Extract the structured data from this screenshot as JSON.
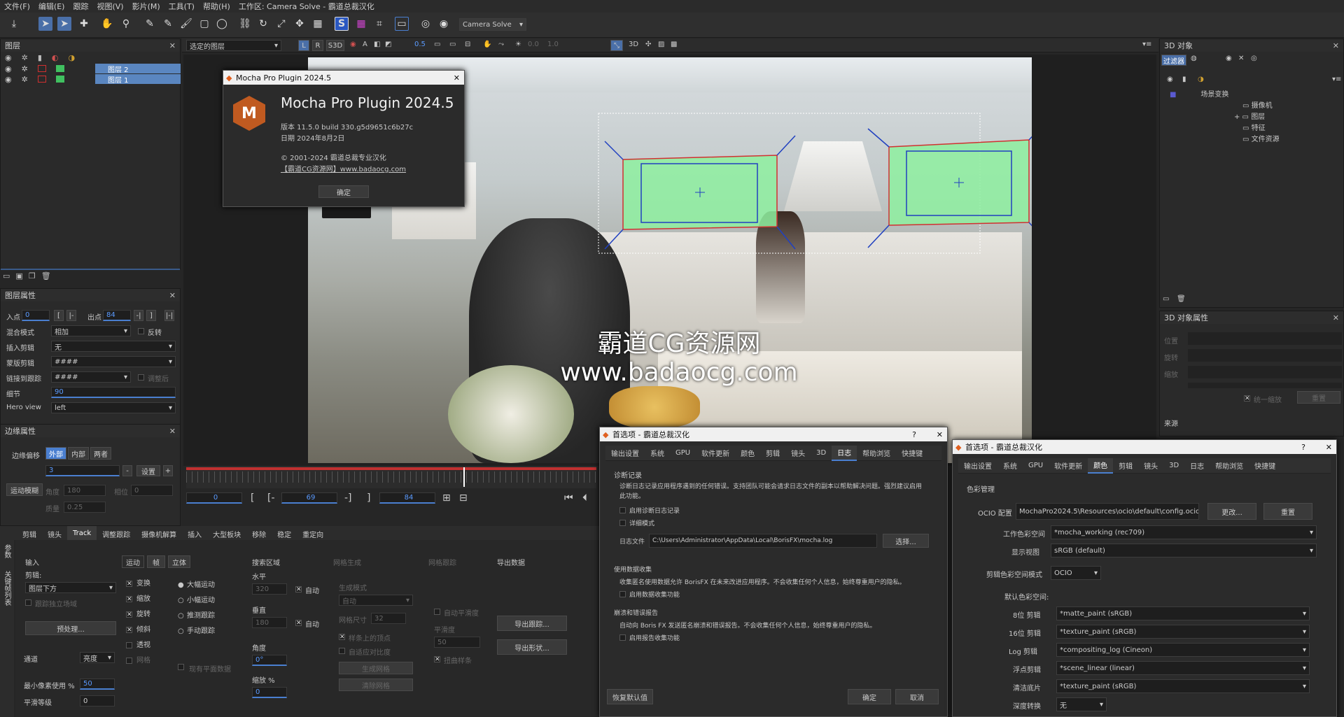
{
  "menu": [
    "文件(F)",
    "编辑(E)",
    "跟踪",
    "视图(V)",
    "影片(M)",
    "工具(T)",
    "帮助(H)",
    "工作区: Camera Solve - 霸道总裁汉化"
  ],
  "toolbar": {
    "workspace_select": "Camera Solve"
  },
  "subbar": {
    "layer_select": "选定的图层",
    "btn_l": "L",
    "btn_r": "R",
    "btn_s3d": "S3D",
    "opacity": "0.5",
    "val1": "0.0",
    "val2": "1.0",
    "btn_3d": "3D"
  },
  "layers_panel": {
    "title": "图层",
    "layers": [
      "图层 2",
      "图层 1"
    ]
  },
  "layer_props": {
    "title": "图层属性",
    "in_label": "入点",
    "in_value": "0",
    "out_label": "出点",
    "out_value": "84",
    "blend_label": "混合模式",
    "blend_value": "相加",
    "invert_label": "反转",
    "insert_label": "插入剪辑",
    "insert_value": "无",
    "matte_label": "蒙版剪辑",
    "matte_value": "####",
    "link_label": "链接到跟踪",
    "link_value": "####",
    "link_after": "调整后",
    "detail_label": "细节",
    "detail_value": "90",
    "hero_label": "Hero view",
    "hero_value": "left"
  },
  "edge_props": {
    "title": "边缘属性",
    "offset_label": "边缘偏移",
    "opt_out": "外部",
    "opt_in": "内部",
    "opt_both": "两者",
    "value": "3",
    "set_label": "设置",
    "motion_blur": "运动模糊",
    "angle_label": "角度",
    "angle_value": "180",
    "phase_label": "相位",
    "phase_value": "0",
    "quality_label": "质量",
    "quality_value": "0.25"
  },
  "bottom_tabs": [
    "剪辑",
    "镜头",
    "Track",
    "调整跟踪",
    "摄像机解算",
    "插入",
    "大型板块",
    "移除",
    "稳定",
    "重定向"
  ],
  "side_tabs": [
    "参数",
    "关键帧列表"
  ],
  "track_params": {
    "input_title": "输入",
    "clip_label": "剪辑:",
    "clip_value": "图层下方",
    "track_separate": "跟踪独立场域",
    "preprocess": "预处理...",
    "channel_label": "通道",
    "channel_value": "亮度",
    "min_pixels_label": "最小像素使用 %",
    "min_pixels_value": "50",
    "smooth_label": "平滑等级",
    "smooth_value": "0",
    "motion_tabs": [
      "运动",
      "帧",
      "立体"
    ],
    "motion_checks": [
      {
        "label": "变换",
        "on": true
      },
      {
        "label": "缩放",
        "on": true
      },
      {
        "label": "旋转",
        "on": true
      },
      {
        "label": "倾斜",
        "on": true
      },
      {
        "label": "透视",
        "on": false
      },
      {
        "label": "网格",
        "on": false
      }
    ],
    "motion_radios": [
      {
        "label": "大幅运动",
        "on": true
      },
      {
        "label": "小幅运动",
        "on": false
      },
      {
        "label": "推测跟踪",
        "on": false
      },
      {
        "label": "手动跟踪",
        "on": false
      }
    ],
    "existing_planar": "现有平面数据",
    "search_title": "搜索区域",
    "horiz_label": "水平",
    "horiz_value": "320",
    "auto1": "自动",
    "vert_label": "垂直",
    "vert_value": "180",
    "auto2": "自动",
    "angle_label": "角度",
    "angle_value": "0°",
    "zoom_label": "缩放 %",
    "zoom_value": "0",
    "mesh_gen_title": "网格生成",
    "gen_mode_label": "生成模式",
    "gen_mode_value": "自动",
    "mesh_size_label": "网格尺寸",
    "mesh_size_value": "32",
    "snap_label": "样条上的顶点",
    "adaptive_label": "自适应对比度",
    "gen_mesh_btn": "生成网格",
    "clear_mesh_btn": "清除网格",
    "mesh_track_title": "网格跟踪",
    "auto_smooth": "自动平滑度",
    "smoothness_label": "平滑度",
    "smoothness_value": "50",
    "warp_label": "扭曲样条",
    "export_title": "导出数据",
    "export_track": "导出跟踪...",
    "export_shape": "导出形状..."
  },
  "timeline": {
    "start": "0",
    "mid": "69",
    "end": "84"
  },
  "objects_panel": {
    "title": "3D 对象",
    "filter": "过滤器",
    "tree": [
      "场景变换",
      "摄像机",
      "图层",
      "特征",
      "文件资源"
    ]
  },
  "objects_props": {
    "title": "3D 对象属性",
    "rows": [
      "位置",
      "旋转",
      "缩放"
    ],
    "uniform_label": "统一缩放",
    "reset_label": "重置",
    "source_label": "来源"
  },
  "about": {
    "title": "Mocha Pro Plugin 2024.5",
    "heading": "Mocha Pro Plugin 2024.5",
    "logo": "M",
    "version": "版本 11.5.0 build 330.g5d9651c6b27c",
    "date": "日期 2024年8月2日",
    "copyright": "© 2001-2024 霸道总裁专业汉化",
    "link": "【霸道CG资源网】www.badaocg.com",
    "ok": "确定"
  },
  "watermark": {
    "line1": "霸道CG资源网",
    "line2": "www.badaocg.com"
  },
  "prefs1": {
    "title": "首选项 - 霸道总裁汉化",
    "help": "?",
    "tabs": [
      "输出设置",
      "系统",
      "GPU",
      "软件更新",
      "颜色",
      "剪辑",
      "镜头",
      "3D",
      "日志",
      "帮助浏览",
      "快捷键"
    ],
    "active": 8,
    "diag_title": "诊断记录",
    "diag_text": "诊断日志记录应用程序遇到的任何错误。支持团队可能会请求日志文件的副本以帮助解决问题。强烈建议启用此功能。",
    "enable_diag": "启用诊断日志记录",
    "verbose": "详细模式",
    "log_file_label": "日志文件",
    "log_file": "C:\\Users\\Administrator\\AppData\\Local\\BorisFX\\mocha.log",
    "choose": "选择...",
    "usage_title": "使用数据收集",
    "usage_text": "收集匿名使用数据允许 BorisFX 在未来改进应用程序。不会收集任何个人信息，始终尊重用户的隐私。",
    "enable_usage": "启用数据收集功能",
    "crash_title": "崩溃和错误报告",
    "crash_text": "自动向 Boris FX 发送匿名崩溃和错误报告。不会收集任何个人信息，始终尊重用户的隐私。",
    "enable_crash": "启用报告收集功能",
    "restore": "恢复默认值",
    "ok": "确定",
    "cancel": "取消"
  },
  "prefs2": {
    "title": "首选项 - 霸道总裁汉化",
    "help": "?",
    "tabs": [
      "输出设置",
      "系统",
      "GPU",
      "软件更新",
      "颜色",
      "剪辑",
      "镜头",
      "3D",
      "日志",
      "帮助浏览",
      "快捷键"
    ],
    "active": 4,
    "section": "色彩管理",
    "ocio_label": "OCIO 配置",
    "ocio_value": "MochaPro2024.5\\Resources\\ocio\\default\\config.ocio",
    "change": "更改...",
    "reset": "重置",
    "working_label": "工作色彩空间",
    "working_value": "*mocha_working (rec709)",
    "view_label": "显示视图",
    "view_value": "sRGB (default)",
    "clip_mode_label": "剪辑色彩空间模式",
    "clip_mode_value": "OCIO",
    "default_label": "默认色彩空间:",
    "rows": [
      {
        "label": "8位 剪辑",
        "value": "*matte_paint (sRGB)"
      },
      {
        "label": "16位 剪辑",
        "value": "*texture_paint (sRGB)"
      },
      {
        "label": "Log 剪辑",
        "value": "*compositing_log (Cineon)"
      },
      {
        "label": "浮点剪辑",
        "value": "*scene_linear (linear)"
      },
      {
        "label": "清洁底片",
        "value": "*texture_paint (sRGB)"
      },
      {
        "label": "深度转换",
        "value": "无"
      }
    ]
  }
}
